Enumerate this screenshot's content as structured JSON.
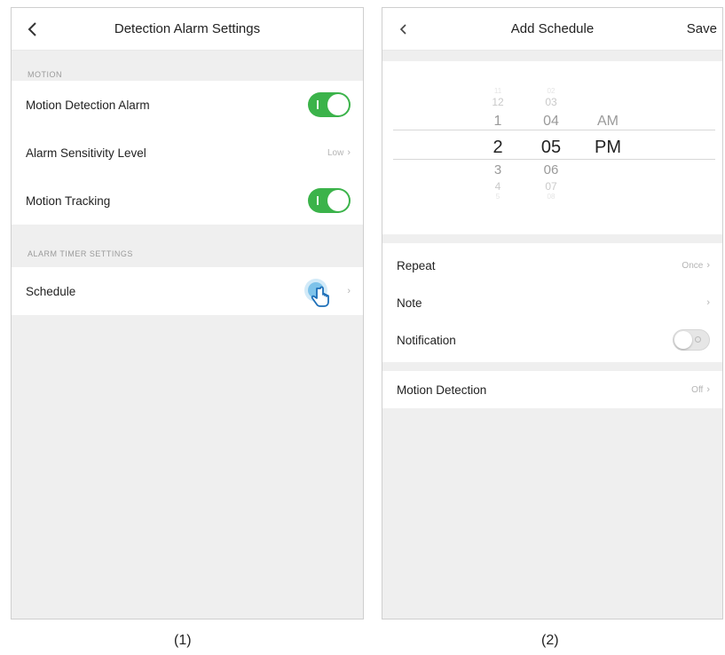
{
  "screen1": {
    "title": "Detection Alarm Settings",
    "motion_section": "MOTION",
    "motion_alarm_label": "Motion Detection Alarm",
    "motion_alarm_on": true,
    "sensitivity_label": "Alarm Sensitivity Level",
    "sensitivity_value": "Low",
    "tracking_label": "Motion Tracking",
    "tracking_on": true,
    "timer_section": "ALARM TIMER SETTINGS",
    "schedule_label": "Schedule",
    "caption": "(1)"
  },
  "screen2": {
    "title": "Add Schedule",
    "save_label": "Save",
    "picker": {
      "hours": [
        "11",
        "12",
        "1",
        "2",
        "3",
        "4",
        "5"
      ],
      "minutes": [
        "02",
        "03",
        "04",
        "05",
        "06",
        "07",
        "08"
      ],
      "am": "AM",
      "pm": "PM"
    },
    "repeat_label": "Repeat",
    "repeat_value": "Once",
    "note_label": "Note",
    "notification_label": "Notification",
    "notification_on": false,
    "motion_label": "Motion Detection",
    "motion_value": "Off",
    "caption": "(2)"
  },
  "colors": {
    "toggle_on": "#3bb34a",
    "background": "#efefef",
    "tap_highlight": "#7ec3ea"
  },
  "icons": [
    "back-chevron-icon",
    "chevron-right-icon",
    "tap-hand-icon",
    "toggle-switch"
  ]
}
